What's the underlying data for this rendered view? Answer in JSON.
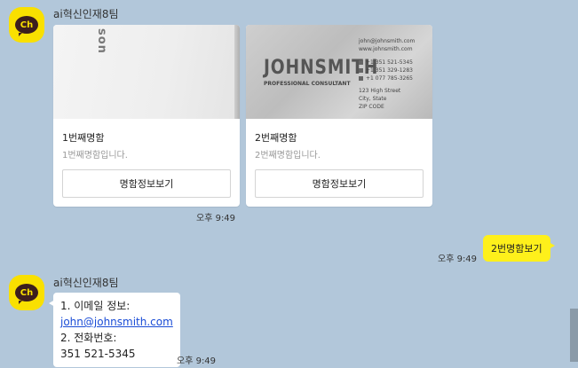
{
  "chat": {
    "bot_name": "ai혁신인재8팀",
    "card1": {
      "title": "1번째명함",
      "desc": "1번째명함입니다.",
      "button": "명함정보보기",
      "thumb_text": "son"
    },
    "card2": {
      "title": "2번째명함",
      "desc": "2번째명함입니다.",
      "button": "명함정보보기",
      "thumb": {
        "name": "JOHNSMITH",
        "subtitle": "PROFESSIONAL CONSULTANT",
        "email": "john@johnsmith.com",
        "web": "www.johnsmith.com",
        "phone1": "+1 351 521-5345",
        "phone2": "+1 351 329-1283",
        "phone3": "+1 077 785-3265",
        "addr1": "123 High Street",
        "addr2": "City, State",
        "addr3": "ZIP CODE"
      }
    },
    "time1": "오후 9:49",
    "my_message": "2번명함보기",
    "my_time": "오후 9:49",
    "reply": {
      "line1": "1. 이메일 정보:",
      "email": "john@johnsmith.com",
      "line3": "2. 전화번호:",
      "line4": "351 521-5345"
    },
    "time2": "오후 9:49"
  },
  "avatar_label": "Ch",
  "colors": {
    "background": "#b2c7da",
    "avatar": "#f9e000",
    "my_bubble": "#fef01b"
  }
}
